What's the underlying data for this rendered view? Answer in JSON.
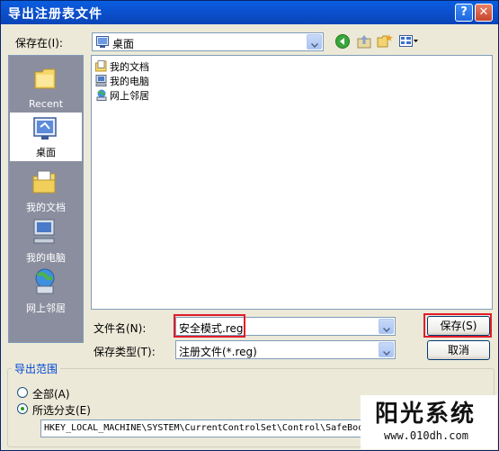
{
  "window": {
    "title": "导出注册表文件",
    "help": "?",
    "close": "✕"
  },
  "save_in": {
    "label": "保存在(I):",
    "value": "桌面"
  },
  "toolbar": {
    "back": "back-icon",
    "up": "up-folder-icon",
    "new_folder": "new-folder-icon",
    "views": "views-menu-icon"
  },
  "places": [
    {
      "label": "Recent",
      "icon": "recent-icon"
    },
    {
      "label": "桌面",
      "icon": "desktop-icon"
    },
    {
      "label": "我的文档",
      "icon": "my-documents-icon"
    },
    {
      "label": "我的电脑",
      "icon": "my-computer-icon"
    },
    {
      "label": "网上邻居",
      "icon": "network-places-icon"
    }
  ],
  "files": [
    {
      "name": "我的文档",
      "icon": "folder-icon"
    },
    {
      "name": "我的电脑",
      "icon": "computer-icon"
    },
    {
      "name": "网上邻居",
      "icon": "network-icon"
    }
  ],
  "filename": {
    "label": "文件名(N):",
    "value": "安全模式.reg"
  },
  "filetype": {
    "label": "保存类型(T):",
    "value": "注册文件(*.reg)"
  },
  "buttons": {
    "save": "保存(S)",
    "cancel": "取消"
  },
  "export_range": {
    "title": "导出范围",
    "all": "全部(A)",
    "selected": "所选分支(E)",
    "selected_checked": true,
    "branch": "HKEY_LOCAL_MACHINE\\SYSTEM\\CurrentControlSet\\Control\\SafeBoot"
  },
  "watermark": {
    "title": "阳光系统",
    "url": "www.010dh.com"
  },
  "colors": {
    "highlight_box": "#E21C2A",
    "title_bar": "#0A5EE0"
  }
}
